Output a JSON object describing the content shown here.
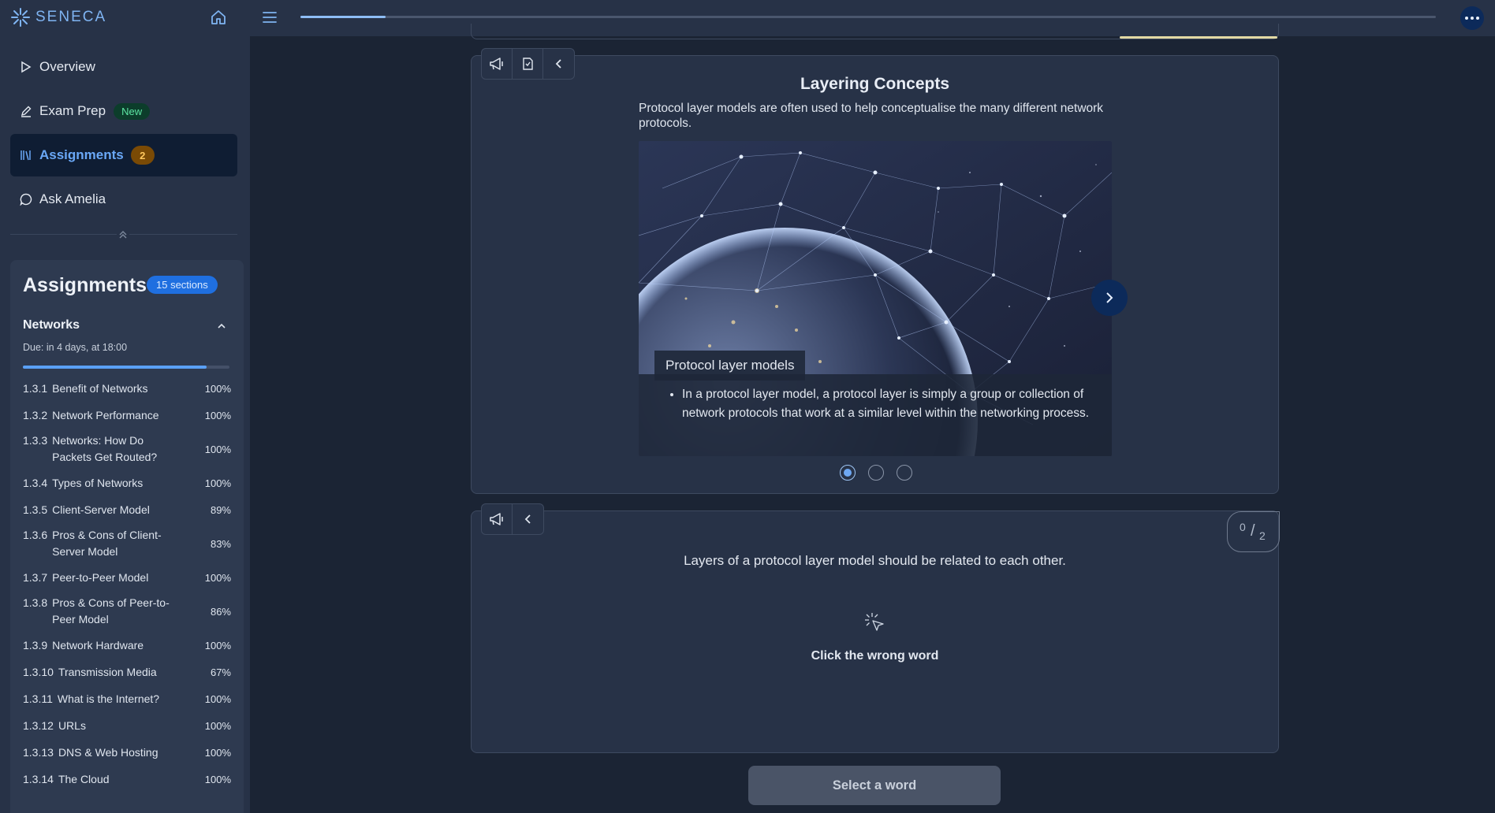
{
  "app": {
    "brand": "SENECA"
  },
  "sidebar": {
    "nav": [
      {
        "label": "Overview",
        "icon": "play-icon"
      },
      {
        "label": "Exam Prep",
        "icon": "pencil-icon",
        "badge": "New"
      },
      {
        "label": "Assignments",
        "icon": "books-icon",
        "badge": "2",
        "active": true
      },
      {
        "label": "Ask Amelia",
        "icon": "chat-icon"
      }
    ]
  },
  "assignments": {
    "title": "Assignments",
    "sections_badge": "15 sections",
    "topic": {
      "name": "Networks",
      "due": "Due: in 4 days, at 18:00",
      "progress": 0.89
    },
    "sections": [
      {
        "num": "1.3.1",
        "title": "Benefit of Networks",
        "pct": "100%"
      },
      {
        "num": "1.3.2",
        "title": "Network Performance",
        "pct": "100%"
      },
      {
        "num": "1.3.3",
        "title": "Networks: How Do Packets Get Routed?",
        "pct": "100%"
      },
      {
        "num": "1.3.4",
        "title": "Types of Networks",
        "pct": "100%"
      },
      {
        "num": "1.3.5",
        "title": "Client-Server Model",
        "pct": "89%"
      },
      {
        "num": "1.3.6",
        "title": "Pros & Cons of Client-Server Model",
        "pct": "83%"
      },
      {
        "num": "1.3.7",
        "title": "Peer-to-Peer Model",
        "pct": "100%"
      },
      {
        "num": "1.3.8",
        "title": "Pros & Cons of Peer-to-Peer Model",
        "pct": "86%"
      },
      {
        "num": "1.3.9",
        "title": "Network Hardware",
        "pct": "100%"
      },
      {
        "num": "1.3.10",
        "title": "Transmission Media",
        "pct": "67%"
      },
      {
        "num": "1.3.11",
        "title": "What is the Internet?",
        "pct": "100%"
      },
      {
        "num": "1.3.12",
        "title": "URLs",
        "pct": "100%"
      },
      {
        "num": "1.3.13",
        "title": "DNS & Web Hosting",
        "pct": "100%"
      },
      {
        "num": "1.3.14",
        "title": "The Cloud",
        "pct": "100%"
      }
    ]
  },
  "topbar": {
    "lesson_progress": 0.075
  },
  "concept": {
    "title": "Layering Concepts",
    "intro": "Protocol layer models are often used to help conceptualise the many different network protocols.",
    "slide_caption": "Protocol layer models",
    "slide_bullet": "In a protocol layer model, a protocol layer is simply a group or collection of network protocols that work at a similar level within the networking process.",
    "slide_count": 3,
    "active_slide": 1
  },
  "quiz": {
    "score": "0",
    "total": "2",
    "statement": "Layers of a protocol layer model should be related to each other.",
    "instruction": "Click the wrong word",
    "button": "Select a word"
  },
  "colors": {
    "accent": "#5aa0f5",
    "sidebar_bg": "#273247",
    "page_bg": "#1b2434",
    "new_badge": "#5ee6a4",
    "count_badge": "#ffc85e"
  }
}
